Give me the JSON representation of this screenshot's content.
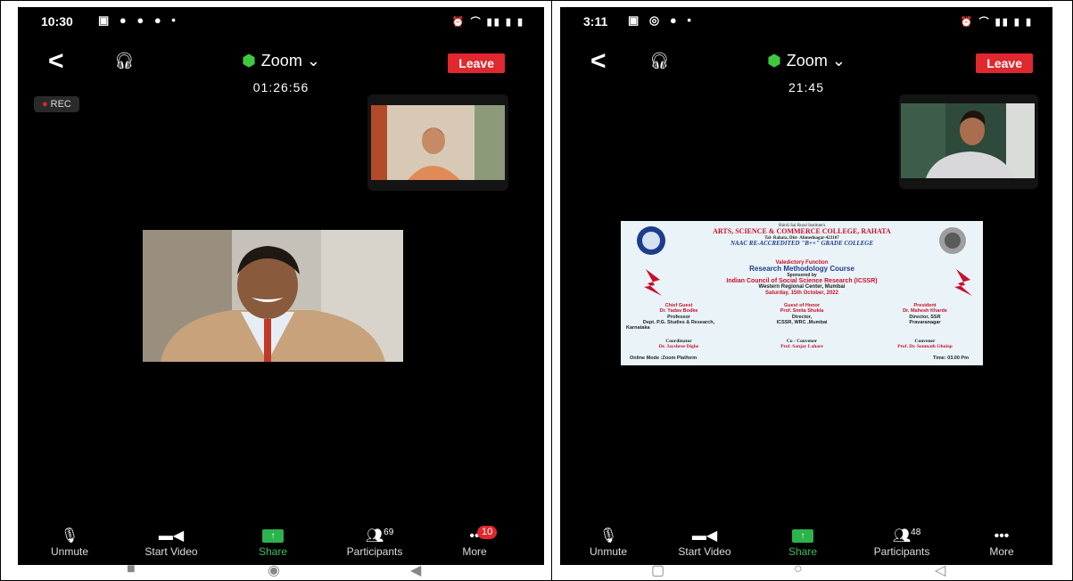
{
  "left": {
    "status_time": "10:30",
    "title": "Zoom",
    "leave_label": "Leave",
    "timer": "01:26:56",
    "rec_label": "REC",
    "toolbar": {
      "unmute": "Unmute",
      "start_video": "Start Video",
      "share": "Share",
      "participants": "Participants",
      "participants_count": "69",
      "more": "More",
      "more_badge": "10"
    }
  },
  "right": {
    "status_time": "3:11",
    "title": "Zoom",
    "leave_label": "Leave",
    "timer": "21:45",
    "toolbar": {
      "unmute": "Unmute",
      "start_video": "Start Video",
      "share": "Share",
      "participants": "Participants",
      "participants_count": "48",
      "more": "More"
    }
  },
  "banner": {
    "trust": "Shirdi Sai Rural Institute's",
    "college": "ARTS, SCIENCE & COMMERCE COLLEGE, RAHATA",
    "address": "Tal- Rahata, Dist- Ahmednagar-423107",
    "naac": "NAAC RE-ACCREDITED \"B++\" GRADE COLLEGE",
    "event": "Valedictory Function",
    "course": "Research Methodology Course",
    "sponsored": "Sponsored by",
    "council": "Indian Council of Social Science Research (ICSSR)",
    "center": "Western Regional Center, Mumbai",
    "date": "Saturday, 15th October, 2022",
    "chief_guest_title": "Chief Guest",
    "chief_guest_name": "Dr. Yadav Bodke",
    "chief_guest_role": "Professor",
    "chief_guest_dept": "Dept. P.G. Studies & Research,",
    "chief_guest_place": "Karnataka",
    "honor_title": "Guest of Honor",
    "honor_name": "Prof. Smita Shukla",
    "honor_role": "Director,",
    "honor_org": "ICSSR, WRC ,Mumbai",
    "president_title": "President",
    "president_name": "Dr. Mahesh Kharde",
    "president_role": "Director, SSR",
    "president_place": "Pravaranagar",
    "coordinator_title": "Coordinator",
    "coordinator_name": "Dr. Jayshree Dighe",
    "coconvener_title": "Co - Convener",
    "coconvener_name": "Prof. Sanjay Lahare",
    "convener_title": "Convener",
    "convener_name": "Prof. Dr. Somnath Gholap",
    "mode": "Online Mode :Zoom Platform",
    "time": "Time: 03.00 Pm"
  },
  "colors": {
    "leave": "#e0282e",
    "share": "#2bb34c",
    "shield": "#3fc93f",
    "banner_red": "#c8102e",
    "banner_blue": "#1f3c8c"
  }
}
